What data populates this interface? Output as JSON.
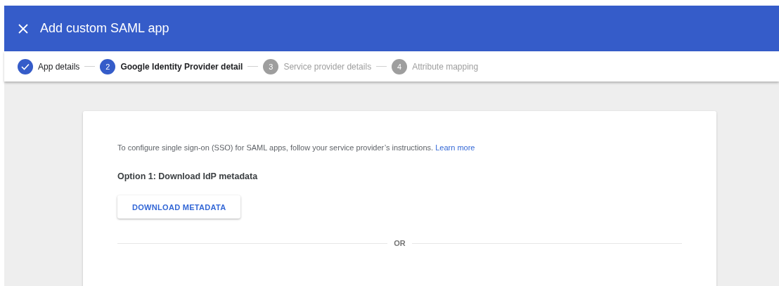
{
  "header": {
    "title": "Add custom SAML app"
  },
  "steps": [
    {
      "label": "App details",
      "completed": true,
      "selected": false
    },
    {
      "number": "2",
      "label": "Google Identity Provider detail",
      "completed": false,
      "selected": true
    },
    {
      "number": "3",
      "label": "Service provider details",
      "completed": false,
      "selected": false
    },
    {
      "number": "4",
      "label": "Attribute mapping",
      "completed": false,
      "selected": false
    }
  ],
  "card": {
    "intro": "To configure single sign-on (SSO) for SAML apps, follow your service provider’s instructions.",
    "link": "Learn more",
    "option_heading": "Option 1: Download IdP metadata",
    "button": "DOWNLOAD METADATA",
    "divider_label": "OR"
  }
}
